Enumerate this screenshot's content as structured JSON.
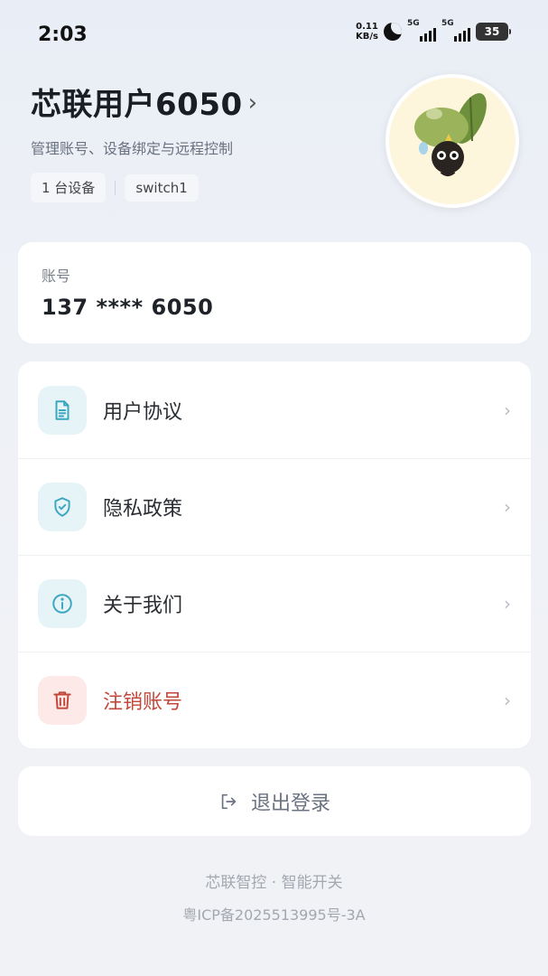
{
  "status_bar": {
    "time": "2:03",
    "net_speed_value": "0.11",
    "net_speed_unit": "KB/s",
    "signal1_label": "5G",
    "signal2_label": "5G",
    "battery": "35"
  },
  "profile": {
    "username": "芯联用户6050",
    "subtitle": "管理账号、设备绑定与远程控制",
    "device_count_tag": "1 台设备",
    "device_name_tag": "switch1"
  },
  "account": {
    "label": "账号",
    "value": "137 **** 6050"
  },
  "menu": {
    "items": [
      {
        "label": "用户协议",
        "icon": "document-icon"
      },
      {
        "label": "隐私政策",
        "icon": "shield-check-icon"
      },
      {
        "label": "关于我们",
        "icon": "info-icon"
      },
      {
        "label": "注销账号",
        "icon": "trash-icon"
      }
    ]
  },
  "logout": {
    "label": "退出登录",
    "icon": "logout-icon"
  },
  "footer": {
    "brand": "芯联智控 · 智能开关",
    "icp": "粤ICP备2025513995号-3A"
  },
  "colors": {
    "accent": "#3aa6c0",
    "danger": "#c2473b",
    "icon_bg": "#e6f4f8",
    "danger_bg": "#fde9e8"
  }
}
